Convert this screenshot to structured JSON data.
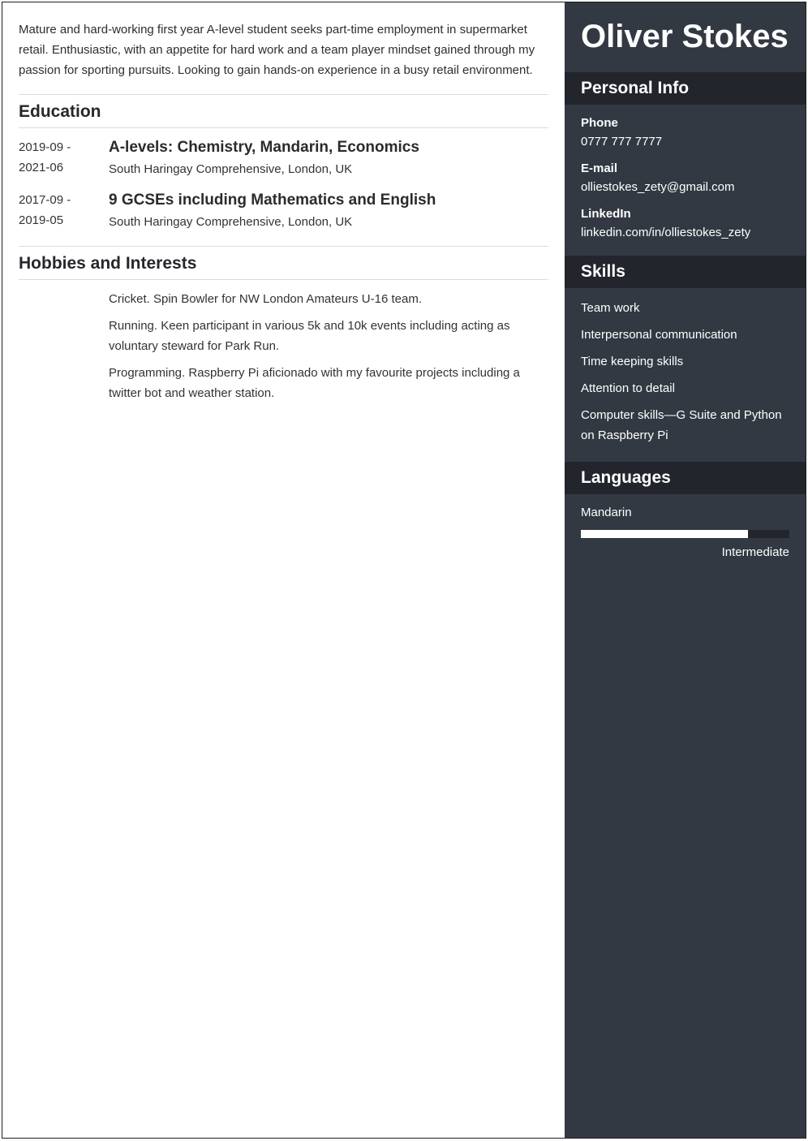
{
  "summary": "Mature and hard-working first year A-level student seeks part-time employment in supermarket retail. Enthusiastic, with an appetite for hard work and a team player mindset gained through my passion for sporting pursuits. Looking to gain hands-on experience in a busy retail environment.",
  "education": {
    "title": "Education",
    "items": [
      {
        "date_start": "2019-09 -",
        "date_end": "2021-06",
        "degree": "A-levels: Chemistry, Mandarin, Economics",
        "school": "South Haringay Comprehensive, London, UK"
      },
      {
        "date_start": "2017-09 -",
        "date_end": "2019-05",
        "degree": "9 GCSEs including Mathematics and English",
        "school": "South Haringay Comprehensive, London, UK"
      }
    ]
  },
  "hobbies": {
    "title": "Hobbies and Interests",
    "items": [
      "Cricket. Spin Bowler for NW London Amateurs U-16 team.",
      "Running. Keen participant in various 5k and 10k events including acting as voluntary steward for Park Run.",
      "Programming. Raspberry Pi aficionado with my favourite projects including a twitter bot and weather station."
    ]
  },
  "sidebar": {
    "name": "Oliver Stokes",
    "personal_info": {
      "title": "Personal Info",
      "phone_label": "Phone",
      "phone": "0777 777 7777",
      "email_label": "E-mail",
      "email": "olliestokes_zety@gmail.com",
      "linkedin_label": "LinkedIn",
      "linkedin": "linkedin.com/in/olliestokes_zety"
    },
    "skills": {
      "title": "Skills",
      "items": [
        "Team work",
        "Interpersonal communication",
        "Time keeping skills",
        "Attention to detail",
        "Computer skills—G Suite and Python on Raspberry Pi"
      ]
    },
    "languages": {
      "title": "Languages",
      "items": [
        {
          "name": "Mandarin",
          "level": "Intermediate",
          "proficiency_percent": 80
        }
      ]
    }
  },
  "colors": {
    "sidebar_bg": "#333943",
    "sidebar_header_bg": "#22252c",
    "text_dark": "#2b2b2b"
  }
}
